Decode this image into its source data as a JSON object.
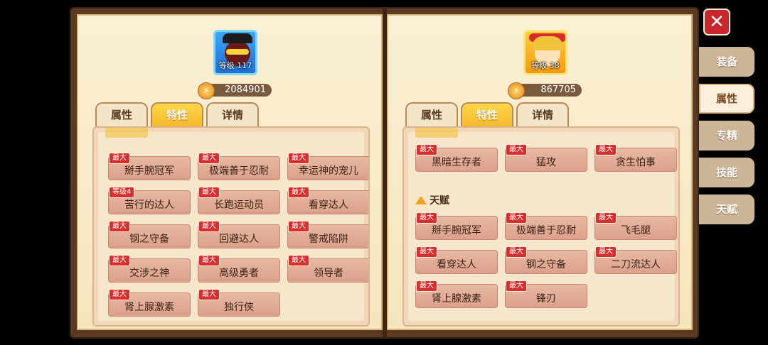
{
  "left": {
    "level": "等级 117",
    "power": "2084901",
    "tabs": [
      "属性",
      "特性",
      "详情"
    ],
    "active_tab": "特性",
    "traits": [
      {
        "tag": "最大",
        "name": "掰手腕冠军"
      },
      {
        "tag": "最大",
        "name": "极端善于忍耐"
      },
      {
        "tag": "最大",
        "name": "幸运神的宠儿"
      },
      {
        "tag": "等级4",
        "name": "苦行的达人"
      },
      {
        "tag": "最大",
        "name": "长跑运动员"
      },
      {
        "tag": "最大",
        "name": "看穿达人"
      },
      {
        "tag": "最大",
        "name": "钢之守备"
      },
      {
        "tag": "最大",
        "name": "回避达人"
      },
      {
        "tag": "最大",
        "name": "警戒陷阱"
      },
      {
        "tag": "最大",
        "name": "交涉之神"
      },
      {
        "tag": "最大",
        "name": "高级勇者"
      },
      {
        "tag": "最大",
        "name": "领导者"
      },
      {
        "tag": "最大",
        "name": "肾上腺激素"
      },
      {
        "tag": "最大",
        "name": "独行侠"
      }
    ]
  },
  "right": {
    "level": "等级 38",
    "power": "867705",
    "tabs": [
      "属性",
      "特性",
      "详情"
    ],
    "active_tab": "特性",
    "traits": [
      {
        "tag": "最大",
        "name": "黑暗生存者"
      },
      {
        "tag": "最大",
        "name": "猛攻"
      },
      {
        "tag": "最大",
        "name": "贪生怕事"
      }
    ],
    "talent_header": "天赋",
    "talents": [
      {
        "tag": "最大",
        "name": "掰手腕冠军"
      },
      {
        "tag": "最大",
        "name": "极端善于忍耐"
      },
      {
        "tag": "最大",
        "name": "飞毛腿"
      },
      {
        "tag": "最大",
        "name": "看穿达人"
      },
      {
        "tag": "最大",
        "name": "钢之守备"
      },
      {
        "tag": "最大",
        "name": "二刀流达人"
      },
      {
        "tag": "最大",
        "name": "肾上腺激素"
      },
      {
        "tag": "最大",
        "name": "锋刃"
      }
    ]
  },
  "close_label": "✕",
  "side_menu": [
    {
      "label": "装备",
      "active": false
    },
    {
      "label": "属性",
      "active": true
    },
    {
      "label": "专精",
      "active": false
    },
    {
      "label": "技能",
      "active": false
    },
    {
      "label": "天赋",
      "active": false
    }
  ]
}
